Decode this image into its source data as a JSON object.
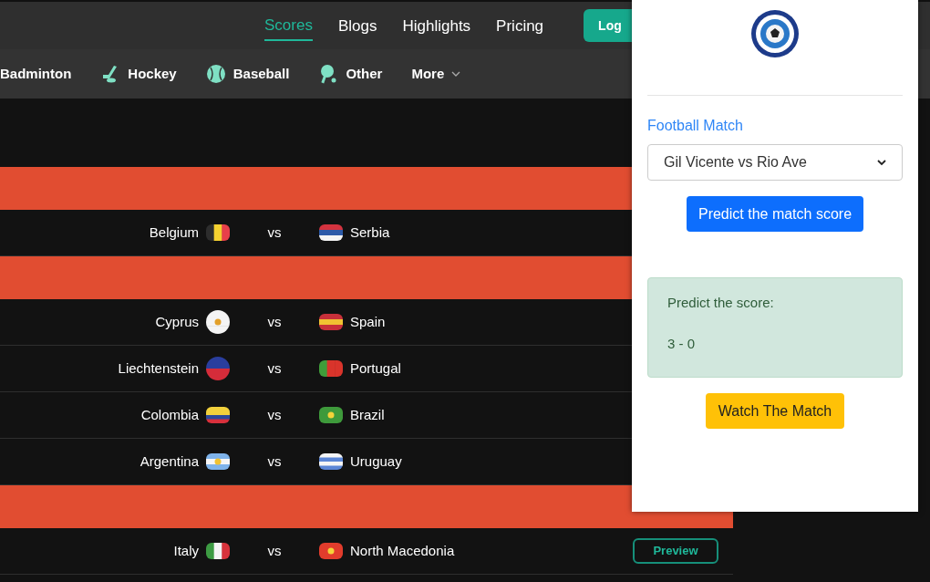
{
  "top_nav": [
    {
      "label": "Scores",
      "selected": true
    },
    {
      "label": "Blogs",
      "selected": false
    },
    {
      "label": "Highlights",
      "selected": false
    },
    {
      "label": "Pricing",
      "selected": false
    }
  ],
  "login_button": "Log",
  "sports": [
    {
      "label": "Badminton",
      "kind": "none"
    },
    {
      "label": "Hockey",
      "kind": "hockey"
    },
    {
      "label": "Baseball",
      "kind": "baseball"
    },
    {
      "label": "Other",
      "kind": "pingpong"
    },
    {
      "label": "More",
      "kind": "more"
    }
  ],
  "rows": [
    {
      "kind": "band"
    },
    {
      "kind": "match",
      "home": "Belgium",
      "vs": "vs",
      "away": "Serbia"
    },
    {
      "kind": "band"
    },
    {
      "kind": "match",
      "home": "Cyprus",
      "vs": "vs",
      "away": "Spain"
    },
    {
      "kind": "match",
      "home": "Liechtenstein",
      "vs": "vs",
      "away": "Portugal"
    },
    {
      "kind": "match",
      "home": "Colombia",
      "vs": "vs",
      "away": "Brazil"
    },
    {
      "kind": "match",
      "home": "Argentina",
      "vs": "vs",
      "away": "Uruguay"
    },
    {
      "kind": "band"
    },
    {
      "kind": "match",
      "home": "Italy",
      "vs": "vs",
      "away": "North Macedonia",
      "action": "Preview"
    }
  ],
  "popup": {
    "label": "Football Match",
    "match_select": "Gil Vicente vs Rio Ave",
    "predict_button": "Predict the match score",
    "result_title": "Predict the score:",
    "result_score": "3 - 0",
    "watch_button": "Watch The Match"
  }
}
